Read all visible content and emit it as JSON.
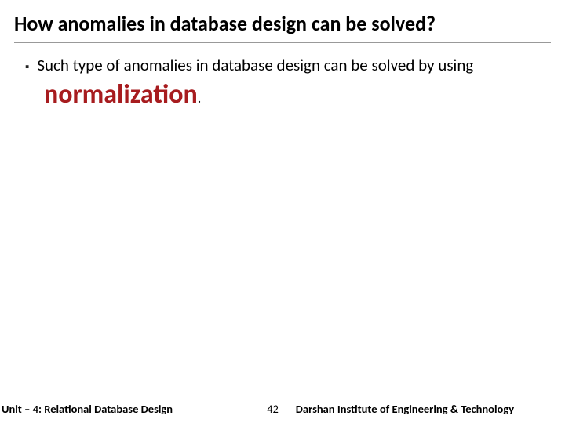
{
  "title": "How anomalies in database design can be solved?",
  "bullet": {
    "marker": "▪",
    "text": "Such type of anomalies in database design can be solved by using",
    "highlight": "normalization",
    "period": "."
  },
  "footer": {
    "left": "Unit – 4: Relational Database Design",
    "page": "42",
    "right": "Darshan Institute of Engineering & Technology"
  }
}
